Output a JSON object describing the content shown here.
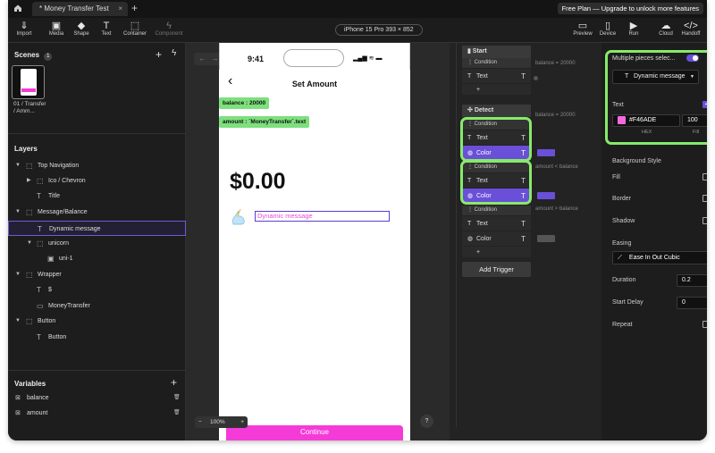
{
  "tabs": {
    "doc_title": "* Money Transfer Test",
    "promo": "Free Plan — Upgrade to unlock more features"
  },
  "toolbar": {
    "import": "Import",
    "media": "Media",
    "shape": "Shape",
    "text": "Text",
    "container": "Container",
    "component": "Component",
    "device": "iPhone 15 Pro  393 × 852",
    "preview": "Preview",
    "device_btn": "Device",
    "run": "Run",
    "cloud": "Cloud",
    "handoff": "Handoff"
  },
  "scenes": {
    "title": "Scenes",
    "count": "1",
    "scene_label": "01 / Transfer / Amm..."
  },
  "layers": {
    "title": "Layers",
    "items": [
      {
        "label": "Top Navigation"
      },
      {
        "label": "Ico / Chevron"
      },
      {
        "label": "Title"
      },
      {
        "label": "Message/Balance"
      },
      {
        "label": "Dynamic message"
      },
      {
        "label": "unicorn"
      },
      {
        "label": "uni-1"
      },
      {
        "label": "Wrapper"
      },
      {
        "label": "$"
      },
      {
        "label": "MoneyTransfer"
      },
      {
        "label": "Button"
      },
      {
        "label": "Button"
      }
    ]
  },
  "variables": {
    "title": "Variables",
    "items": [
      {
        "label": "balance"
      },
      {
        "label": "amount"
      }
    ]
  },
  "phone": {
    "time": "9:41",
    "title": "Set Amount",
    "amount": "$0.00",
    "dynamic_message": "Dynamic message",
    "continue": "Continue"
  },
  "canvas_tags": {
    "balance": "balance : 20000",
    "amount": "amount : `MoneyTransfer`.text"
  },
  "zoom": "100%",
  "help": "?",
  "logic": {
    "start": "Start",
    "detect": "Detect",
    "condition": "Condition",
    "text": "Text",
    "color": "Color",
    "add_trigger": "Add Trigger",
    "track_start": "balance = 20000",
    "track_d1": "balance = 20000",
    "track_d2": "amount < balance",
    "track_d3": "amount > balance",
    "plus": "+"
  },
  "props": {
    "multiple": "Multiple pieces selec...",
    "dropdown": "Dynamic message",
    "text_section": "Text",
    "hex_value": "#F46ADE",
    "fill_value": "100",
    "hex_label": "HEX",
    "fill_label": "Fill",
    "background_style": "Background Style",
    "fill": "Fill",
    "border": "Border",
    "shadow": "Shadow",
    "easing": "Easing",
    "easing_value": "Ease In Out Cubic",
    "duration": "Duration",
    "duration_value": "0.2",
    "start_delay": "Start Delay",
    "start_delay_value": "0",
    "repeat": "Repeat"
  },
  "colors": {
    "accent": "#6a4fd9",
    "highlight": "#86ea6a",
    "pink": "#F46ADE",
    "button": "#f53bd7"
  }
}
